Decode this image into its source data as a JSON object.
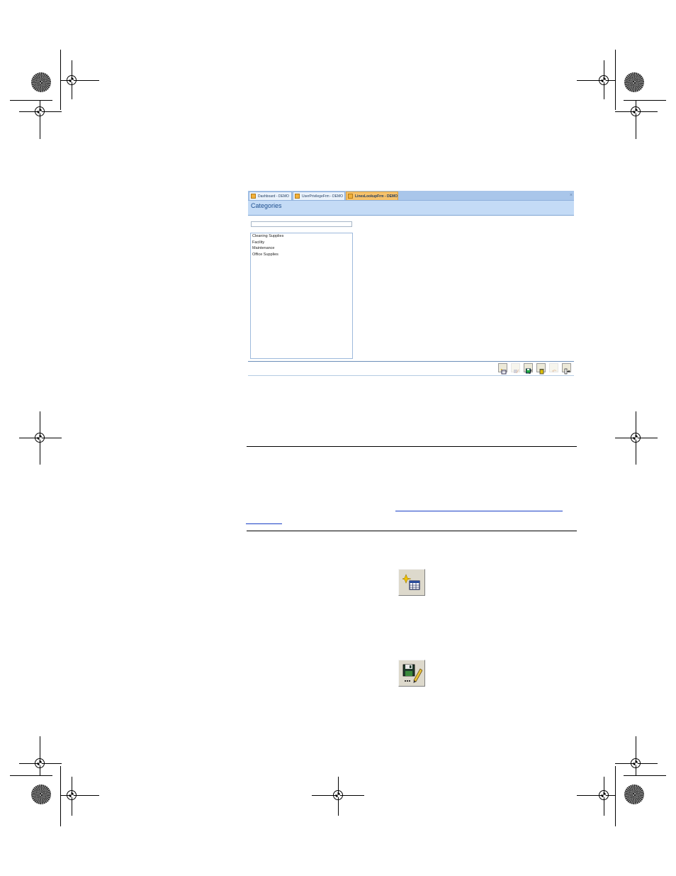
{
  "app": {
    "tabs": [
      {
        "label": "Dashboard - DEMO",
        "active": false
      },
      {
        "label": "UserPrivilegeFrm - DEMO",
        "active": false
      },
      {
        "label": "LinesLookupFrm - DEMO",
        "active": true
      }
    ],
    "close_glyph": "×",
    "form_title": "Categories",
    "search": {
      "value": "",
      "placeholder": ""
    },
    "categories": [
      "Cleaning Supplies",
      "Facility",
      "Maintenance",
      "Office Supplies"
    ],
    "toolbar": [
      {
        "icon": "new-record-icon",
        "enabled": true
      },
      {
        "icon": "edit-record-icon",
        "enabled": false
      },
      {
        "icon": "save-record-icon",
        "enabled": true
      },
      {
        "icon": "delete-icon",
        "enabled": true
      },
      {
        "icon": "undo-icon",
        "enabled": false
      },
      {
        "icon": "exit-icon",
        "enabled": true
      }
    ]
  },
  "document": {
    "link_line_1": "",
    "link_line_2": ""
  },
  "icons": {
    "new_record_large": "new-record-icon",
    "save_edit_large": "save-edit-icon"
  },
  "colors": {
    "tab_bar": "#a9c6ea",
    "active_tab": "#f6c26b",
    "header": "#c4dbf6",
    "title_text": "#1e4f8f",
    "link": "#1a3fc6"
  }
}
